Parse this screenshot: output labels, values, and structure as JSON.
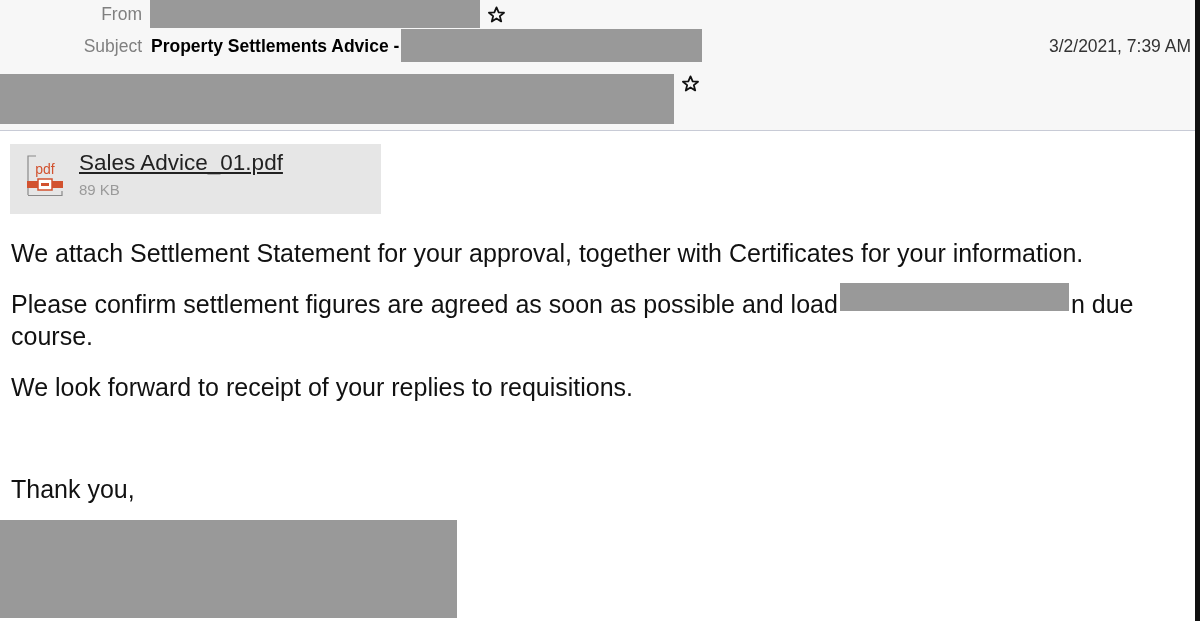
{
  "header": {
    "from": {
      "label": "From"
    },
    "subject": {
      "label": "Subject",
      "value": "Property Settlements Advice -"
    },
    "date": "3/2/2021, 7:39 AM"
  },
  "attachment": {
    "icon_label": "pdf",
    "name": "Sales Advice_01.pdf",
    "size": "89 KB"
  },
  "body": {
    "paragraphs": [
      {
        "kind": "plain",
        "text": "We attach Settlement Statement for your approval, together with Certificates for your information."
      },
      {
        "kind": "redacted",
        "before": "Please confirm settlement figures are agreed as soon as possible and load",
        "after": "n due",
        "continuation": "course."
      },
      {
        "kind": "plain",
        "text": "We look forward to receipt of your replies to requisitions."
      }
    ],
    "closing": "Thank you,"
  }
}
